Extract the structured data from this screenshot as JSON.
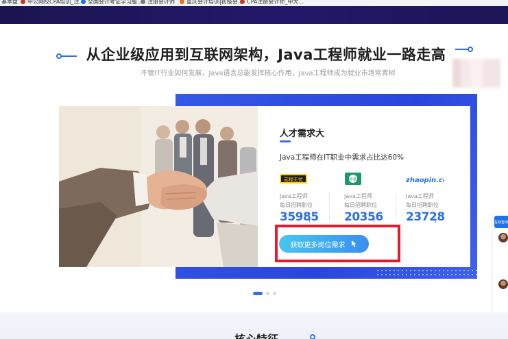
{
  "bookmarks": [
    {
      "label": "基本盘",
      "icon": "bookmark-icon"
    },
    {
      "label": "中公网校CPA培训_注...",
      "icon": "site-icon"
    },
    {
      "label": "全国会计考证学习服...",
      "icon": "site-icon"
    },
    {
      "label": "注册会计师",
      "icon": "globe-icon"
    },
    {
      "label": "重庆会计培训|初级会...",
      "icon": "site-icon"
    },
    {
      "label": "CPA注册会计师_中大...",
      "icon": "site-icon"
    }
  ],
  "section": {
    "headline": "从企业级应用到互联网架构，Java工程师就业一路走高",
    "subheadline": "不管IT行业如何发展，Java语言总能发挥核心作用，Java工程师成为就业市场常青树"
  },
  "card": {
    "title": "人才需求大",
    "description": "Java工程师在IT职业中需求占比达60%",
    "stats": [
      {
        "logo": "前程无忧",
        "label_line1": "Java工程师",
        "label_line2": "每日招聘职位",
        "value": "35985",
        "arrow": "↑"
      },
      {
        "logo": "中华英才",
        "label_line1": "Java工程师",
        "label_line2": "每日招聘职位",
        "value": "20356",
        "arrow": "↑"
      },
      {
        "logo": "zhaopin.com",
        "label_line1": "Java工程师",
        "label_line2": "每日招聘职位",
        "value": "23728",
        "arrow": "↑"
      }
    ],
    "cta_label": "获取更多岗位需求"
  },
  "carousel": {
    "count": 3,
    "active_index": 0
  },
  "float_sidebar": {
    "tab_label": "在线咨询"
  },
  "bottom": {
    "heading": "核心特征"
  },
  "colors": {
    "accent": "#2f6fe4",
    "card_blue": "#2a45db",
    "highlight": "#e8192c",
    "topbar": "#1f1760"
  }
}
